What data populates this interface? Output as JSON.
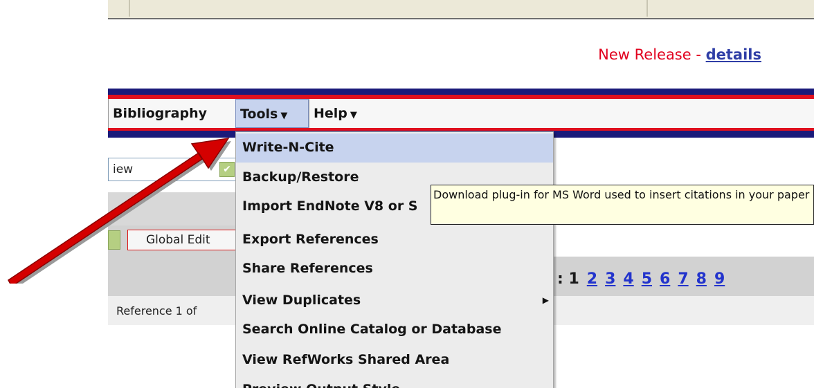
{
  "header": {
    "release_label": "New Release - ",
    "release_link": "details",
    "release_color": "#e1001e"
  },
  "nav": {
    "items": [
      {
        "label": "Bibliography",
        "caret": ""
      },
      {
        "label": "Tools",
        "caret": "▼"
      },
      {
        "label": "Help",
        "caret": "▼"
      }
    ],
    "active_item": "Tools",
    "accent_navy": "#1a1a7a",
    "accent_red": "#e0101e"
  },
  "view": {
    "selected_value": "iew"
  },
  "toolbar": {
    "global_edit_label": "Global Edit"
  },
  "pager": {
    "prefix": ": 1",
    "pages": [
      "2",
      "3",
      "4",
      "5",
      "6",
      "7",
      "8",
      "9"
    ]
  },
  "reference": {
    "text": "Reference 1 of"
  },
  "tools_menu": {
    "items": [
      {
        "label": "Write-N-Cite",
        "highlighted": true,
        "has_submenu": false
      },
      {
        "label": "Backup/Restore",
        "highlighted": false,
        "has_submenu": false
      },
      {
        "label": "Import EndNote V8 or S",
        "highlighted": false,
        "has_submenu": false
      },
      {
        "label": "Export References",
        "highlighted": false,
        "has_submenu": false
      },
      {
        "label": "Share References",
        "highlighted": false,
        "has_submenu": false
      },
      {
        "label": "View Duplicates",
        "highlighted": false,
        "has_submenu": true
      },
      {
        "label": "Search Online Catalog or Database",
        "highlighted": false,
        "has_submenu": false
      },
      {
        "label": "View RefWorks Shared Area",
        "highlighted": false,
        "has_submenu": false
      },
      {
        "label": "Preview Output Style",
        "highlighted": false,
        "has_submenu": false
      }
    ]
  },
  "tooltip": {
    "text": "Download plug-in for MS Word used to insert citations in your paper"
  },
  "annotation": {
    "arrow_color": "#d40000",
    "arrow_icon": "red-pointer-arrow-icon"
  }
}
